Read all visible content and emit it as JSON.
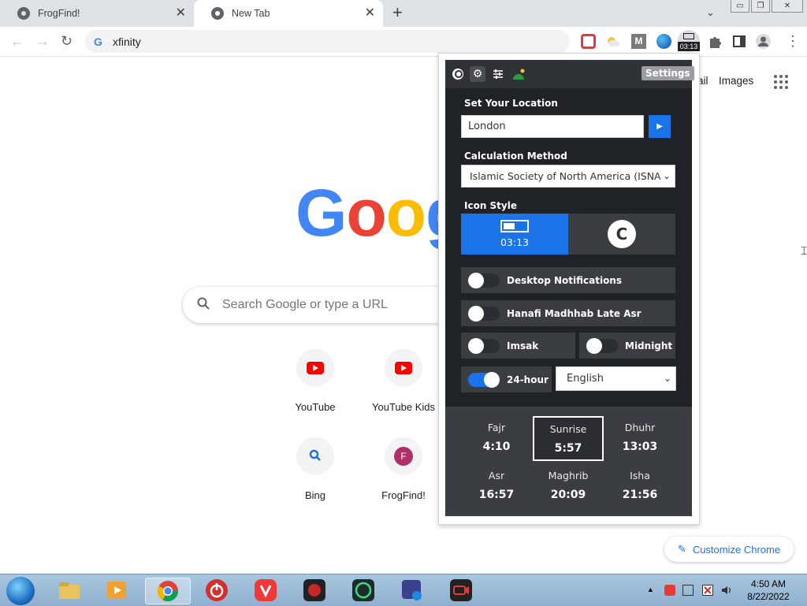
{
  "browser": {
    "tabs": [
      {
        "title": "FrogFind!"
      },
      {
        "title": "New Tab"
      }
    ],
    "new_tab_symbol": "+",
    "close_symbol": "✕",
    "tab_search_symbol": "⌄",
    "window_controls": [
      "▭",
      "❐",
      "✕"
    ],
    "nav": {
      "back": "←",
      "forward": "→",
      "reload": "↻"
    },
    "omnibox": {
      "text": "xfinity",
      "icon": "google-g-icon"
    },
    "extension_badge": "03:13",
    "menu_symbol": "⋮"
  },
  "ntp": {
    "links": [
      "ail",
      "Images"
    ],
    "logo_letters": [
      "G",
      "o",
      "o",
      "g"
    ],
    "logo_colors": [
      "#4285f4",
      "#ea4335",
      "#fbbc05",
      "#4285f4"
    ],
    "search_placeholder": "Search Google or type a URL",
    "shortcuts": [
      {
        "label": "YouTube",
        "icon": "youtube-icon"
      },
      {
        "label": "YouTube Kids",
        "icon": "youtube-icon"
      },
      {
        "label": "Bing",
        "icon": "search-icon"
      },
      {
        "label": "FrogFind!",
        "icon": "F"
      }
    ],
    "customize_label": "Customize Chrome"
  },
  "popup": {
    "settings_badge": "Settings",
    "location_label": "Set Your Location",
    "location_value": "London",
    "method_label": "Calculation Method",
    "method_value": "Islamic Society of North America (ISNA)",
    "icon_style_label": "Icon Style",
    "icon_style_time": "03:13",
    "icon_style_logo": "C",
    "toggles": [
      {
        "label": "Desktop Notifications",
        "on": false
      },
      {
        "label": "Hanafi Madhhab Late Asr",
        "on": false
      },
      {
        "label": "Imsak",
        "on": false
      },
      {
        "label": "Midnight",
        "on": false
      },
      {
        "label": "24-hour",
        "on": true
      }
    ],
    "language_value": "English",
    "prayer_times": [
      {
        "name": "Fajr",
        "time": "4:10"
      },
      {
        "name": "Sunrise",
        "time": "5:57",
        "current": true
      },
      {
        "name": "Dhuhr",
        "time": "13:03"
      },
      {
        "name": "Asr",
        "time": "16:57"
      },
      {
        "name": "Maghrib",
        "time": "20:09"
      },
      {
        "name": "Isha",
        "time": "21:56"
      }
    ]
  },
  "taskbar": {
    "time": "4:50 AM",
    "date": "8/22/2022",
    "show_hidden_symbol": "▲"
  },
  "colors": {
    "panel_bg": "#2f3236",
    "accent_blue": "#1a73e8",
    "tabstrip_bg": "#dee1e6"
  }
}
